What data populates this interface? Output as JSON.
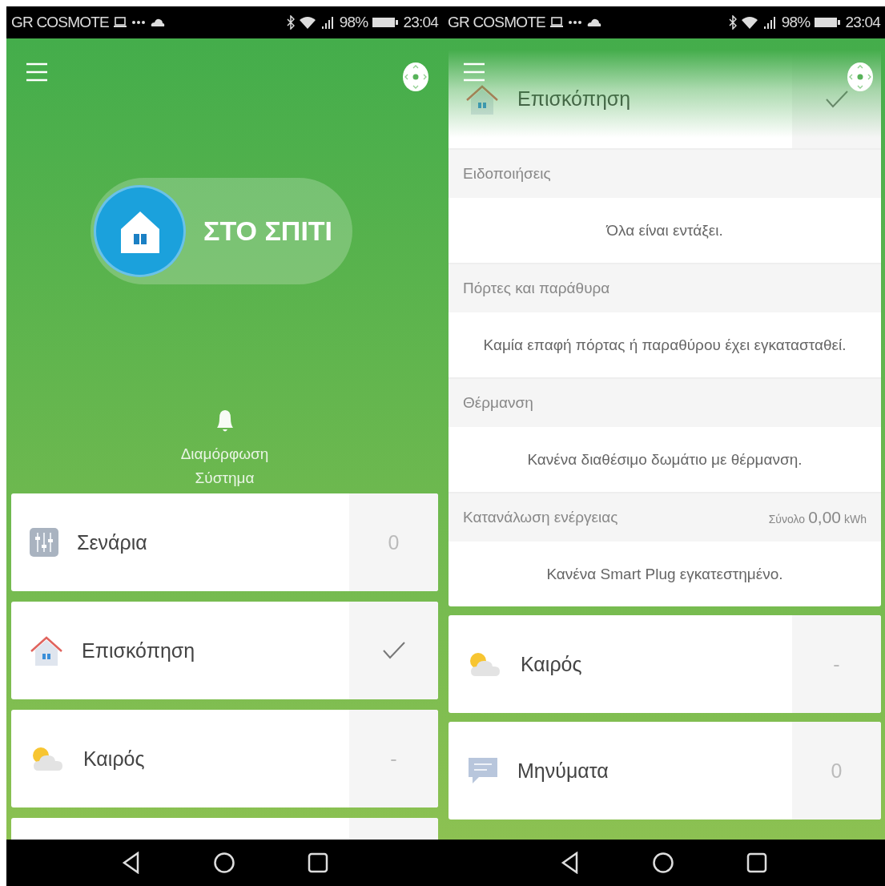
{
  "screens": [
    {
      "status_bar": {
        "carrier": "GR COSMOTE",
        "battery": "98%",
        "time": "23:04"
      },
      "mode_button": {
        "label": "ΣΤΟ ΣΠΙΤΙ"
      },
      "system_setup": {
        "lines": [
          "Διαμόρφωση",
          "Σύστημα"
        ]
      },
      "tiles": [
        {
          "kind": "scenes",
          "label": "Σενάρια",
          "value": "0",
          "checked": false
        },
        {
          "kind": "overview",
          "label": "Επισκόπηση",
          "checked": true
        },
        {
          "kind": "weather",
          "label": "Καιρός",
          "value": "-",
          "checked": false
        },
        {
          "kind": "empty",
          "checked": false
        }
      ]
    },
    {
      "status_bar": {
        "carrier": "GR COSMOTE",
        "battery": "98%",
        "time": "23:04"
      },
      "overview": {
        "kind": "overview",
        "title": "Επισκόπηση",
        "checked": true,
        "sections": [
          {
            "heading": "Ειδοποιήσεις",
            "message": "Όλα είναι εντάξει."
          },
          {
            "heading": "Πόρτες και παράθυρα",
            "message": "Καμία επαφή πόρτας ή παραθύρου έχει εγκατασταθεί."
          },
          {
            "heading": "Θέρμανση",
            "message": "Κανένα διαθέσιμο δωμάτιο με θέρμανση."
          },
          {
            "heading": "Κατανάλωση ενέργειας",
            "total_label": "Σύνολο",
            "total_value": "0,00",
            "total_unit": "kWh",
            "message": "Κανένα Smart Plug εγκατεστημένο."
          }
        ]
      },
      "tiles": [
        {
          "kind": "weather",
          "label": "Καιρός",
          "value": "-",
          "checked": false
        },
        {
          "kind": "messages",
          "label": "Μηνύματα",
          "value": "0",
          "checked": false
        }
      ]
    }
  ]
}
